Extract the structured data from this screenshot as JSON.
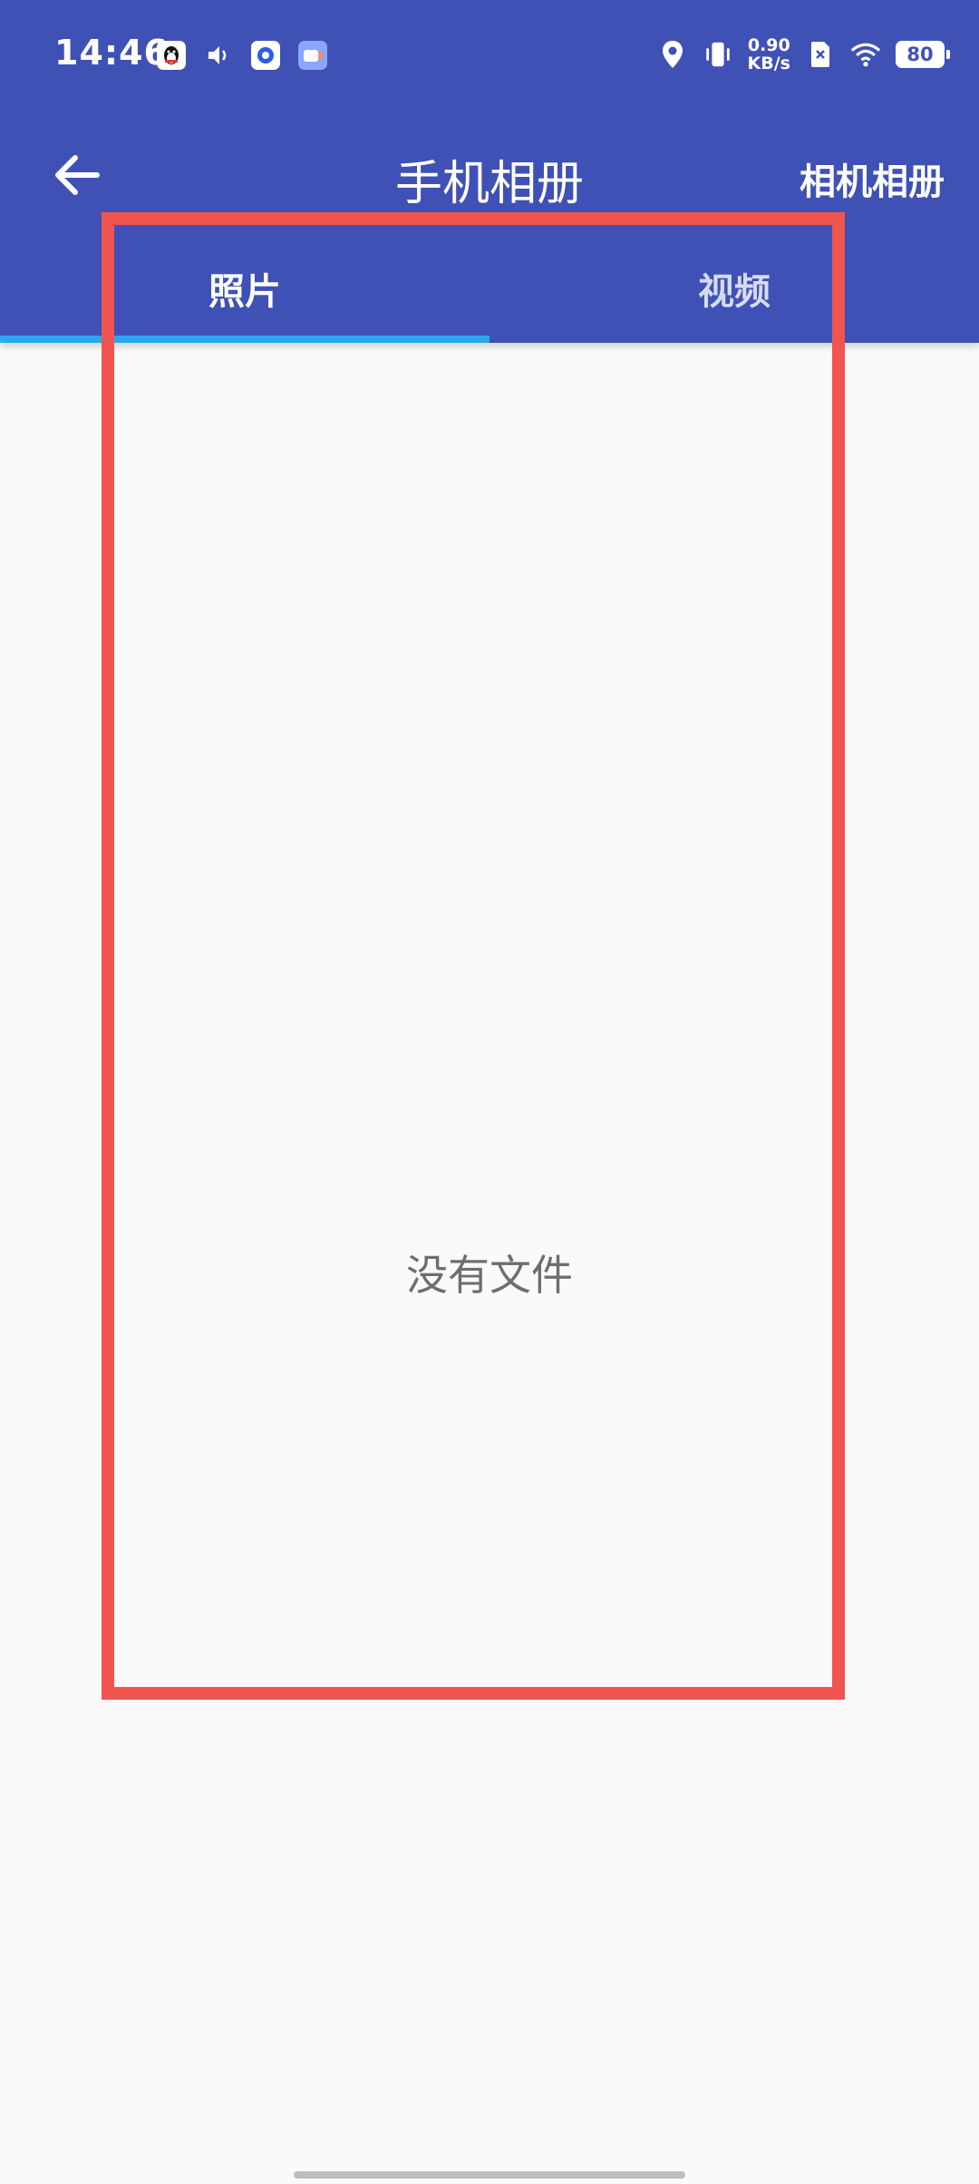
{
  "status_bar": {
    "time": "14:46",
    "net_speed_value": "0.90",
    "net_speed_unit": "KB/s",
    "battery_level": "80",
    "left_icons": [
      "qq-icon",
      "volume-icon",
      "circle-app-icon",
      "camera-app-icon"
    ],
    "right_icons": [
      "location-icon",
      "vibrate-icon",
      "sim-off-icon",
      "wifi-icon",
      "battery-icon"
    ]
  },
  "toolbar": {
    "title": "手机相册",
    "action_label": "相机相册",
    "back_icon": "arrow-left-icon"
  },
  "tabs": [
    {
      "label": "照片",
      "active": true
    },
    {
      "label": "视频",
      "active": false
    }
  ],
  "content": {
    "empty_message": "没有文件"
  },
  "colors": {
    "primary": "#3f51b5",
    "tab_indicator": "#29a8ec",
    "highlight": "#f0554f",
    "background": "#fafafa"
  }
}
